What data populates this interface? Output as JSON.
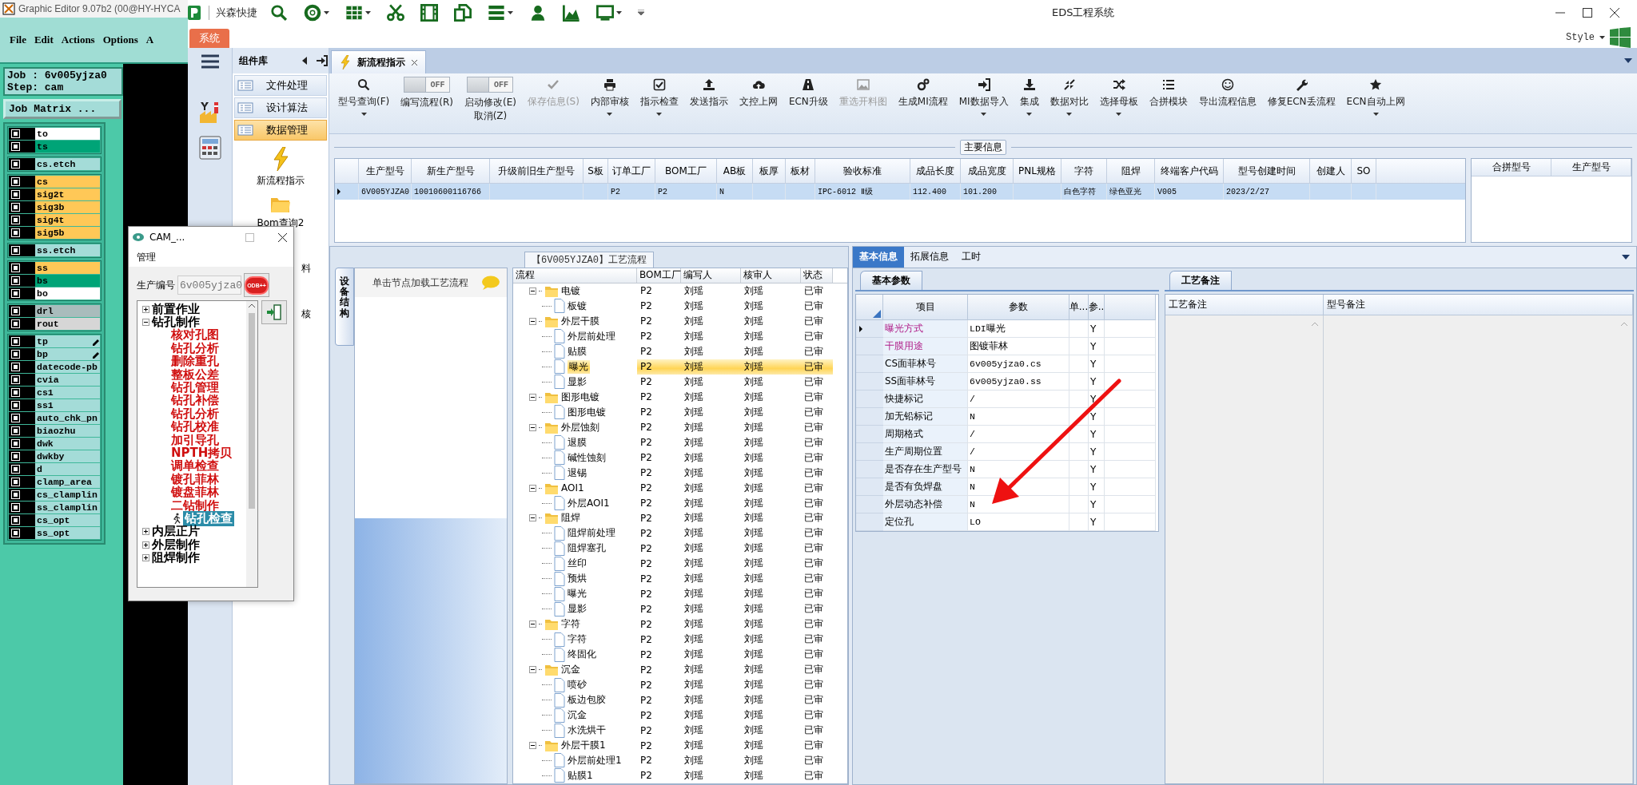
{
  "graphic_editor": {
    "title": "Graphic Editor 9.07b2 (00@HY-HYCA",
    "menu": [
      "File",
      "Edit",
      "Actions",
      "Options",
      "A"
    ],
    "job": "Job : 6v005yjza0",
    "step": "Step: cam",
    "job_matrix_button": "Job Matrix ...",
    "layer_groups": [
      [
        {
          "name": "to",
          "color": "#ffffff",
          "flagged": false,
          "checked": false
        },
        {
          "name": "ts",
          "color": "#00a477",
          "flagged": false,
          "checked": false
        }
      ],
      [
        {
          "name": "cs.etch",
          "color": "#a4dcd8",
          "flagged": false,
          "checked": false
        }
      ],
      [
        {
          "name": "cs",
          "color": "#ffc857",
          "flagged": false,
          "checked": false
        },
        {
          "name": "sig2t",
          "color": "#ffc857",
          "flagged": false,
          "checked": false
        },
        {
          "name": "sig3b",
          "color": "#ffc857",
          "flagged": false,
          "checked": false
        },
        {
          "name": "sig4t",
          "color": "#ffc857",
          "flagged": false,
          "checked": false
        },
        {
          "name": "sig5b",
          "color": "#ffc857",
          "flagged": false,
          "checked": false
        }
      ],
      [
        {
          "name": "ss.etch",
          "color": "#a4dcd8",
          "flagged": false,
          "checked": false
        }
      ],
      [
        {
          "name": "ss",
          "color": "#ffc857",
          "flagged": false,
          "checked": false
        },
        {
          "name": "bs",
          "color": "#00a477",
          "flagged": false,
          "checked": false
        },
        {
          "name": "bo",
          "color": "#ffffff",
          "flagged": false,
          "checked": false
        }
      ],
      [
        {
          "name": "drl",
          "color": "#a9bcbc",
          "flagged": false,
          "checked": false
        },
        {
          "name": "rout",
          "color": "#d6d6d6",
          "flagged": false,
          "checked": false
        }
      ],
      [
        {
          "name": "tp",
          "color": "#a4dcd8",
          "flagged": true,
          "checked": false
        },
        {
          "name": "bp",
          "color": "#a4dcd8",
          "flagged": true,
          "checked": false
        },
        {
          "name": "datecode-pb",
          "color": "#a4dcd8",
          "flagged": false,
          "checked": false
        },
        {
          "name": "cvia",
          "color": "#a4dcd8",
          "flagged": false,
          "checked": false
        },
        {
          "name": "cs1",
          "color": "#a4dcd8",
          "flagged": false,
          "checked": false
        },
        {
          "name": "ss1",
          "color": "#a4dcd8",
          "flagged": false,
          "checked": false
        },
        {
          "name": "auto_chk_pn",
          "color": "#a4dcd8",
          "flagged": false,
          "checked": false
        },
        {
          "name": "biaozhu",
          "color": "#a4dcd8",
          "flagged": false,
          "checked": false
        },
        {
          "name": "dwk",
          "color": "#a4dcd8",
          "flagged": false,
          "checked": false
        },
        {
          "name": "dwkby",
          "color": "#a4dcd8",
          "flagged": false,
          "checked": false
        },
        {
          "name": "d",
          "color": "#a4dcd8",
          "flagged": false,
          "checked": false
        },
        {
          "name": "clamp_area",
          "color": "#a4dcd8",
          "flagged": false,
          "checked": false
        },
        {
          "name": "cs_clamplin",
          "color": "#a4dcd8",
          "flagged": false,
          "checked": false
        },
        {
          "name": "ss_clamplin",
          "color": "#a4dcd8",
          "flagged": false,
          "checked": false
        },
        {
          "name": "cs_opt",
          "color": "#a4dcd8",
          "flagged": false,
          "checked": false
        },
        {
          "name": "ss_opt",
          "color": "#a4dcd8",
          "flagged": false,
          "checked": false
        }
      ]
    ]
  },
  "eds": {
    "quick_title": "兴森快捷",
    "title": "EDS工程系统",
    "system_tab": "系统",
    "style": "Style",
    "library_title": "组件库",
    "modules": [
      {
        "label": "文件处理",
        "selected": false
      },
      {
        "label": "设计算法",
        "selected": false
      },
      {
        "label": "数据管理",
        "selected": true
      }
    ],
    "tools": [
      {
        "label": "新流程指示",
        "kind": "bolt"
      },
      {
        "label": "Bom查询2",
        "kind": "folder"
      },
      {
        "label": "料",
        "kind": "text"
      },
      {
        "label": "核",
        "kind": "text"
      }
    ],
    "doc_tabs": [
      {
        "label": "新流程指示",
        "selected": true
      }
    ],
    "ribbon": [
      {
        "kind": "button",
        "label": "型号查询(F)",
        "dropdown": true,
        "disabled": false
      },
      {
        "kind": "toggle",
        "label": "编写流程(R)",
        "switch_text": "OFF",
        "on": false
      },
      {
        "kind": "toggle",
        "label": "启动修改(E)",
        "sublabel": "取消(Z)",
        "switch_text": "OFF",
        "on": false
      },
      {
        "kind": "button",
        "label": "保存信息(S)",
        "dropdown": false,
        "disabled": true
      },
      {
        "kind": "button",
        "label": "内部审核",
        "dropdown": true,
        "disabled": false
      },
      {
        "kind": "button",
        "label": "指示检查",
        "dropdown": true,
        "disabled": false
      },
      {
        "kind": "button",
        "label": "发送指示",
        "dropdown": false,
        "disabled": false
      },
      {
        "kind": "button",
        "label": "文控上网",
        "dropdown": false,
        "disabled": false
      },
      {
        "kind": "button",
        "label": "ECN升级",
        "dropdown": false,
        "disabled": false
      },
      {
        "kind": "button",
        "label": "重选开料图",
        "dropdown": false,
        "disabled": true
      },
      {
        "kind": "button",
        "label": "生成MI流程",
        "dropdown": false,
        "disabled": false
      },
      {
        "kind": "button",
        "label": "MI数据导入",
        "dropdown": true,
        "disabled": false
      },
      {
        "kind": "button",
        "label": "集成",
        "dropdown": true,
        "disabled": false
      },
      {
        "kind": "button",
        "label": "数据对比",
        "dropdown": true,
        "disabled": false
      },
      {
        "kind": "button",
        "label": "选择母板",
        "dropdown": true,
        "disabled": false
      },
      {
        "kind": "button",
        "label": "合拼模块",
        "dropdown": false,
        "disabled": false
      },
      {
        "kind": "button",
        "label": "导出流程信息",
        "dropdown": false,
        "disabled": false
      },
      {
        "kind": "button",
        "label": "修复ECN丢流程",
        "dropdown": false,
        "disabled": false
      },
      {
        "kind": "button",
        "label": "ECN自动上网",
        "dropdown": true,
        "disabled": false
      }
    ],
    "main_info": {
      "title": "主要信息",
      "columns": [
        "生产型号",
        "新生产型号",
        "升级前旧生产型号",
        "S板",
        "订单工厂",
        "BOM工厂",
        "AB板",
        "板厚",
        "板材",
        "验收标准",
        "成品长度",
        "成品宽度",
        "PNL规格",
        "字符",
        "阻焊",
        "终端客户代码",
        "型号创建时间",
        "创建人",
        "SO"
      ],
      "rows": [
        {
          "selected": true,
          "cells": [
            "6V005YJZA0",
            "10010600116766",
            null,
            null,
            "P2",
            "P2",
            "N",
            null,
            null,
            "IPC-6012 Ⅱ级",
            "112.400",
            "101.200",
            null,
            "白色字符",
            "绿色亚光",
            "V005",
            "2023/2/27",
            null,
            null
          ]
        }
      ],
      "merge_columns": [
        "合拼型号",
        "生产型号"
      ]
    },
    "process": {
      "title": "【6V005YJZA0】工艺流程",
      "side_tab": "设备结构",
      "hint": "单击节点加载工艺流程",
      "columns": [
        "流程",
        "BOM工厂",
        "编写人",
        "核审人",
        "状态"
      ],
      "nodes": [
        {
          "name": "电镀",
          "factory": "P2",
          "writer": "刘瑶",
          "reviewer": "刘瑶",
          "status": "已审",
          "selected": false,
          "expanded": true,
          "children": [
            {
              "name": "板镀",
              "factory": "P2",
              "writer": "刘瑶",
              "reviewer": "刘瑶",
              "status": "已审",
              "selected": false
            }
          ]
        },
        {
          "name": "外层干膜",
          "factory": "P2",
          "writer": "刘瑶",
          "reviewer": "刘瑶",
          "status": "已审",
          "selected": false,
          "expanded": true,
          "children": [
            {
              "name": "外层前处理",
              "factory": "P2",
              "writer": "刘瑶",
              "reviewer": "刘瑶",
              "status": "已审",
              "selected": false
            },
            {
              "name": "贴膜",
              "factory": "P2",
              "writer": "刘瑶",
              "reviewer": "刘瑶",
              "status": "已审",
              "selected": false
            },
            {
              "name": "曝光",
              "factory": "P2",
              "writer": "刘瑶",
              "reviewer": "刘瑶",
              "status": "已审",
              "selected": true
            },
            {
              "name": "显影",
              "factory": "P2",
              "writer": "刘瑶",
              "reviewer": "刘瑶",
              "status": "已审",
              "selected": false
            }
          ]
        },
        {
          "name": "图形电镀",
          "factory": "P2",
          "writer": "刘瑶",
          "reviewer": "刘瑶",
          "status": "已审",
          "selected": false,
          "expanded": true,
          "children": [
            {
              "name": "图形电镀",
              "factory": "P2",
              "writer": "刘瑶",
              "reviewer": "刘瑶",
              "status": "已审",
              "selected": false
            }
          ]
        },
        {
          "name": "外层蚀刻",
          "factory": "P2",
          "writer": "刘瑶",
          "reviewer": "刘瑶",
          "status": "已审",
          "selected": false,
          "expanded": true,
          "children": [
            {
              "name": "退膜",
              "factory": "P2",
              "writer": "刘瑶",
              "reviewer": "刘瑶",
              "status": "已审",
              "selected": false
            },
            {
              "name": "碱性蚀刻",
              "factory": "P2",
              "writer": "刘瑶",
              "reviewer": "刘瑶",
              "status": "已审",
              "selected": false
            },
            {
              "name": "退锡",
              "factory": "P2",
              "writer": "刘瑶",
              "reviewer": "刘瑶",
              "status": "已审",
              "selected": false
            }
          ]
        },
        {
          "name": "AOI1",
          "factory": "P2",
          "writer": "刘瑶",
          "reviewer": "刘瑶",
          "status": "已审",
          "selected": false,
          "expanded": true,
          "children": [
            {
              "name": "外层AOI1",
              "factory": "P2",
              "writer": "刘瑶",
              "reviewer": "刘瑶",
              "status": "已审",
              "selected": false
            }
          ]
        },
        {
          "name": "阻焊",
          "factory": "P2",
          "writer": "刘瑶",
          "reviewer": "刘瑶",
          "status": "已审",
          "selected": false,
          "expanded": true,
          "children": [
            {
              "name": "阻焊前处理",
              "factory": "P2",
              "writer": "刘瑶",
              "reviewer": "刘瑶",
              "status": "已审",
              "selected": false
            },
            {
              "name": "阻焊塞孔",
              "factory": "P2",
              "writer": "刘瑶",
              "reviewer": "刘瑶",
              "status": "已审",
              "selected": false
            },
            {
              "name": "丝印",
              "factory": "P2",
              "writer": "刘瑶",
              "reviewer": "刘瑶",
              "status": "已审",
              "selected": false
            },
            {
              "name": "预烘",
              "factory": "P2",
              "writer": "刘瑶",
              "reviewer": "刘瑶",
              "status": "已审",
              "selected": false
            },
            {
              "name": "曝光",
              "factory": "P2",
              "writer": "刘瑶",
              "reviewer": "刘瑶",
              "status": "已审",
              "selected": false
            },
            {
              "name": "显影",
              "factory": "P2",
              "writer": "刘瑶",
              "reviewer": "刘瑶",
              "status": "已审",
              "selected": false
            }
          ]
        },
        {
          "name": "字符",
          "factory": "P2",
          "writer": "刘瑶",
          "reviewer": "刘瑶",
          "status": "已审",
          "selected": false,
          "expanded": true,
          "children": [
            {
              "name": "字符",
              "factory": "P2",
              "writer": "刘瑶",
              "reviewer": "刘瑶",
              "status": "已审",
              "selected": false
            },
            {
              "name": "终固化",
              "factory": "P2",
              "writer": "刘瑶",
              "reviewer": "刘瑶",
              "status": "已审",
              "selected": false
            }
          ]
        },
        {
          "name": "沉金",
          "factory": "P2",
          "writer": "刘瑶",
          "reviewer": "刘瑶",
          "status": "已审",
          "selected": false,
          "expanded": true,
          "children": [
            {
              "name": "喷砂",
              "factory": "P2",
              "writer": "刘瑶",
              "reviewer": "刘瑶",
              "status": "已审",
              "selected": false
            },
            {
              "name": "板边包胶",
              "factory": "P2",
              "writer": "刘瑶",
              "reviewer": "刘瑶",
              "status": "已审",
              "selected": false
            },
            {
              "name": "沉金",
              "factory": "P2",
              "writer": "刘瑶",
              "reviewer": "刘瑶",
              "status": "已审",
              "selected": false
            },
            {
              "name": "水洗烘干",
              "factory": "P2",
              "writer": "刘瑶",
              "reviewer": "刘瑶",
              "status": "已审",
              "selected": false
            }
          ]
        },
        {
          "name": "外层干膜1",
          "factory": "P2",
          "writer": "刘瑶",
          "reviewer": "刘瑶",
          "status": "已审",
          "selected": false,
          "expanded": true,
          "children": [
            {
              "name": "外层前处理1",
              "factory": "P2",
              "writer": "刘瑶",
              "reviewer": "刘瑶",
              "status": "已审",
              "selected": false
            },
            {
              "name": "贴膜1",
              "factory": "P2",
              "writer": "刘瑶",
              "reviewer": "刘瑶",
              "status": "已审",
              "selected": false
            }
          ]
        }
      ]
    },
    "detail_tabs": [
      {
        "label": "基本信息",
        "selected": true
      },
      {
        "label": "拓展信息",
        "selected": false
      },
      {
        "label": "工时",
        "selected": false
      }
    ],
    "basic_params": {
      "tab": "基本参数",
      "columns": [
        "项目",
        "参数",
        "单...",
        "参.."
      ],
      "rows": [
        {
          "item": "曝光方式",
          "value": "LDI曝光",
          "flag": "Y",
          "emphasized": true,
          "selected": true
        },
        {
          "item": "干膜用途",
          "value": "图镀菲林",
          "flag": "Y",
          "emphasized": true,
          "selected": false
        },
        {
          "item": "CS面菲林号",
          "value": "6v005yjza0.cs",
          "flag": "Y",
          "emphasized": false,
          "selected": false
        },
        {
          "item": "SS面菲林号",
          "value": "6v005yjza0.ss",
          "flag": "Y",
          "emphasized": false,
          "selected": false
        },
        {
          "item": "快捷标记",
          "value": "/",
          "flag": "Y",
          "emphasized": false,
          "selected": false
        },
        {
          "item": "加无铅标记",
          "value": "N",
          "flag": "Y",
          "emphasized": false,
          "selected": false
        },
        {
          "item": "周期格式",
          "value": "/",
          "flag": "Y",
          "emphasized": false,
          "selected": false
        },
        {
          "item": "生产周期位置",
          "value": "/",
          "flag": "Y",
          "emphasized": false,
          "selected": false
        },
        {
          "item": "是否存在生产型号",
          "value": "N",
          "flag": "Y",
          "emphasized": false,
          "selected": false
        },
        {
          "item": "是否有负焊盘",
          "value": "N",
          "flag": "Y",
          "emphasized": false,
          "selected": false
        },
        {
          "item": "外层动态补偿",
          "value": "N",
          "flag": "Y",
          "emphasized": false,
          "selected": false
        },
        {
          "item": "定位孔",
          "value": "LO",
          "flag": "Y",
          "emphasized": false,
          "selected": false
        }
      ]
    },
    "remarks": {
      "tab": "工艺备注",
      "columns": [
        "工艺备注",
        "型号备注"
      ]
    }
  },
  "cam_window": {
    "title": "CAM_...",
    "menu": [
      "管理"
    ],
    "field_label": "生产编号",
    "field_value": "6v005yjza0",
    "odb_button": "ODB++",
    "tree": [
      {
        "label": "前置作业",
        "expanded": false
      },
      {
        "label": "钻孔制作",
        "expanded": true,
        "children": [
          {
            "label": "核对孔图",
            "selected": false
          },
          {
            "label": "钻孔分析",
            "selected": false
          },
          {
            "label": "删除重孔",
            "selected": false
          },
          {
            "label": "整板公差",
            "selected": false
          },
          {
            "label": "钻孔管理",
            "selected": false
          },
          {
            "label": "钻孔补偿",
            "selected": false
          },
          {
            "label": "钻孔分析",
            "selected": false
          },
          {
            "label": "钻孔校准",
            "selected": false
          },
          {
            "label": "加引导孔",
            "selected": false
          },
          {
            "label": "NPTH拷贝",
            "selected": false
          },
          {
            "label": "调单检查",
            "selected": false
          },
          {
            "label": "镀孔菲林",
            "selected": false
          },
          {
            "label": "镀盘菲林",
            "selected": false
          },
          {
            "label": "二钻制作",
            "selected": false
          },
          {
            "label": "钻孔检查",
            "selected": true
          }
        ]
      },
      {
        "label": "内层正片",
        "expanded": false
      },
      {
        "label": "外层制作",
        "expanded": false
      },
      {
        "label": "阻焊制作",
        "expanded": false
      }
    ]
  }
}
